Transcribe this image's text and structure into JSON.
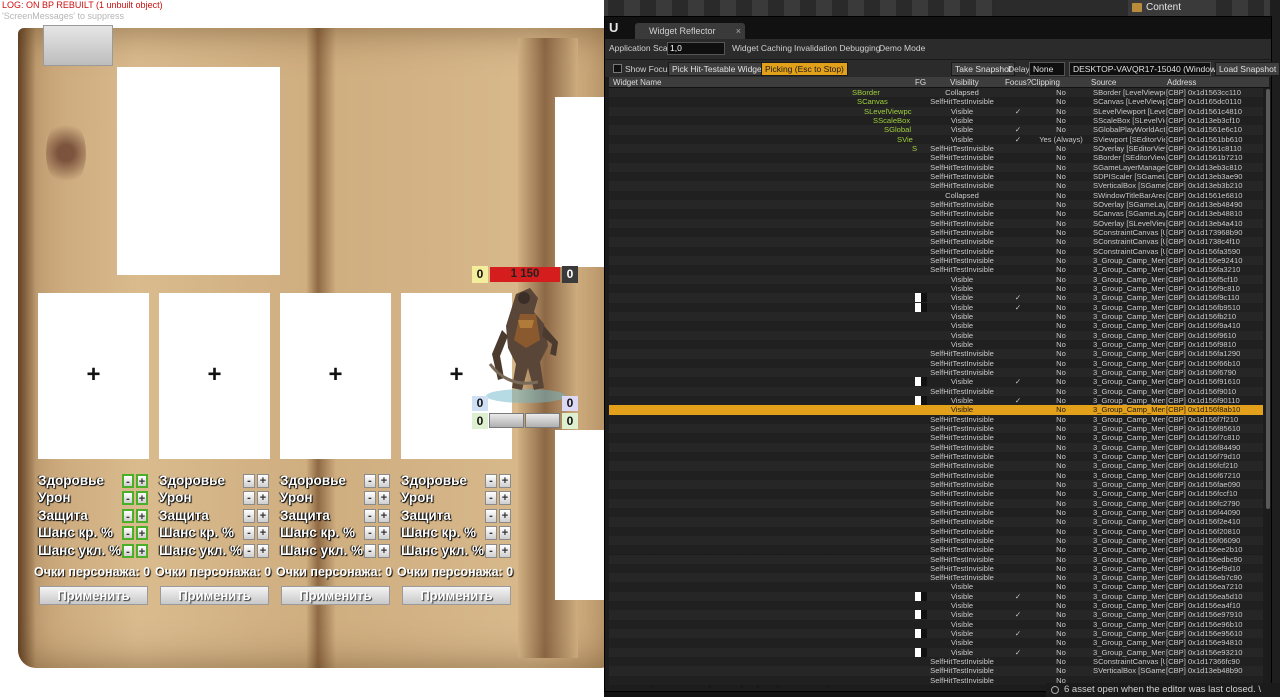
{
  "debug": {
    "message": "LOG: ON BP REBUILT (1 unbuilt object)",
    "hint": "'ScreenMessages' to suppress"
  },
  "game": {
    "slots": [
      "+",
      "+",
      "+",
      "+"
    ],
    "stat_labels": [
      "Здоровье",
      "Урон",
      "Защита",
      "Шанс кр. %",
      "Шанс укл. %"
    ],
    "minus": "-",
    "plus": "+",
    "points_label": "Очки персонажа:",
    "points_values": [
      "0",
      "0",
      "0",
      "0"
    ],
    "apply_label": "Применить",
    "enemy": {
      "stat_left": "0",
      "health": "1 150",
      "stat_right": "0",
      "bottom_tl": "0",
      "bottom_tr": "0",
      "bottom_bl": "0",
      "bottom_br": "0"
    }
  },
  "reflector": {
    "title": "Widget Reflector",
    "logo": "U",
    "tab_close": "×",
    "toolbar1": {
      "scale_label": "Application Scale:",
      "scale_value": "1,0",
      "widget_caching": "Widget Caching",
      "invalidation_debugging": "Invalidation Debugging",
      "demo_mode": "Demo Mode"
    },
    "toolbar2": {
      "show_focus": "Show Focus",
      "pick_hit_testable": "Pick Hit-Testable Widgets",
      "picking": "Picking (Esc to Stop)",
      "take_snapshot": "Take Snapshot",
      "delay_label": "Delay",
      "delay_value": "None",
      "target": "DESKTOP-VAVQR17-15040 (Windows)",
      "load_snapshot": "Load Snapshot"
    },
    "columns": [
      "Widget Name",
      "FG",
      "Visibility",
      "Focus?",
      "Clipping",
      "Source",
      "Address"
    ],
    "rows": [
      {
        "name": "SBorder",
        "vis": "Collapsed",
        "focus": "",
        "clip": "No",
        "src": "SBorder [LevelViewport",
        "addr": "[CBP] 0x1d1563cc110",
        "fg": false
      },
      {
        "name": "SCanvas",
        "vis": "SelfHitTestInvisible",
        "focus": "",
        "clip": "No",
        "src": "SCanvas [LevelViewport",
        "addr": "[CBP] 0x1d165dc0110",
        "fg": false
      },
      {
        "name": "SLevelViewpc",
        "vis": "Visible",
        "focus": "✓",
        "clip": "No",
        "src": "SLevelViewport [Level",
        "addr": "[CBP] 0x1d1561c4810",
        "fg": false
      },
      {
        "name": "SScaleBox",
        "vis": "Visible",
        "focus": "",
        "clip": "No",
        "src": "SScaleBox [SLevelViewp",
        "addr": "[CBP] 0x1d13eb3cf10",
        "fg": false
      },
      {
        "name": "SGlobal",
        "vis": "Visible",
        "focus": "✓",
        "clip": "No",
        "src": "SGlobalPlayWorldActio",
        "addr": "[CBP] 0x1d1561e6c10",
        "fg": false
      },
      {
        "name": "SVie",
        "vis": "Visible",
        "focus": "✓",
        "clip": "Yes (Always)",
        "src": "SViewport [SEditorView",
        "addr": "[CBP] 0x1d1561bb610",
        "fg": false
      },
      {
        "name": "S",
        "vis": "SelfHitTestInvisible",
        "focus": "",
        "clip": "No",
        "src": "SOverlay [SEditorView",
        "addr": "[CBP] 0x1d1561c8110",
        "fg": false
      },
      {
        "name": "",
        "vis": "SelfHitTestInvisible",
        "focus": "",
        "clip": "No",
        "src": "SBorder [SEditorViewp",
        "addr": "[CBP] 0x1d1561b7210",
        "fg": false
      },
      {
        "name": "",
        "vis": "SelfHitTestInvisible",
        "focus": "",
        "clip": "No",
        "src": "SGameLayerManager [",
        "addr": "[CBP] 0x1d13eb3c810",
        "fg": false
      },
      {
        "name": "",
        "vis": "SelfHitTestInvisible",
        "focus": "",
        "clip": "No",
        "src": "SDPIScaler [SGameLay",
        "addr": "[CBP] 0x1d13eb3ae90",
        "fg": false
      },
      {
        "name": "",
        "vis": "SelfHitTestInvisible",
        "focus": "",
        "clip": "No",
        "src": "SVerticalBox [SGameLa",
        "addr": "[CBP] 0x1d13eb3b210",
        "fg": false
      },
      {
        "name": "",
        "vis": "Collapsed",
        "focus": "",
        "clip": "No",
        "src": "SWindowTitleBarArea [",
        "addr": "[CBP] 0x1d1561e6810",
        "fg": false
      },
      {
        "name": "",
        "vis": "SelfHitTestInvisible",
        "focus": "",
        "clip": "No",
        "src": "SOverlay [SGameLayer",
        "addr": "[CBP] 0x1d13eb48490",
        "fg": false
      },
      {
        "name": "",
        "vis": "SelfHitTestInvisible",
        "focus": "",
        "clip": "No",
        "src": "SCanvas [SGameLayerl",
        "addr": "[CBP] 0x1d13eb48810",
        "fg": false
      },
      {
        "name": "",
        "vis": "SelfHitTestInvisible",
        "focus": "",
        "clip": "No",
        "src": "SOverlay [SLevelViewp",
        "addr": "[CBP] 0x1d13eb4a410",
        "fg": false
      },
      {
        "name": "",
        "vis": "SelfHitTestInvisible",
        "focus": "",
        "clip": "No",
        "src": "SConstraintCanvas [Us",
        "addr": "[CBP] 0x1d173968b90",
        "fg": false
      },
      {
        "name": "",
        "vis": "SelfHitTestInvisible",
        "focus": "",
        "clip": "No",
        "src": "SConstraintCanvas [Us",
        "addr": "[CBP] 0x1d1738c4f10",
        "fg": false
      },
      {
        "name": "",
        "vis": "SelfHitTestInvisible",
        "focus": "",
        "clip": "No",
        "src": "SConstraintCanvas [Us",
        "addr": "[CBP] 0x1d156fa3590",
        "fg": false
      },
      {
        "name": "",
        "vis": "SelfHitTestInvisible",
        "focus": "",
        "clip": "No",
        "src": "3_Group_Camp_Menu [",
        "addr": "[CBP] 0x1d156e92410",
        "fg": false
      },
      {
        "name": "",
        "vis": "SelfHitTestInvisible",
        "focus": "",
        "clip": "No",
        "src": "3_Group_Camp_Menu [",
        "addr": "[CBP] 0x1d156fa3210",
        "fg": false
      },
      {
        "name": "",
        "vis": "Visible",
        "focus": "",
        "clip": "No",
        "src": "3_Group_Camp_Menu [",
        "addr": "[CBP] 0x1d156f5cf10",
        "fg": false
      },
      {
        "name": "",
        "vis": "Visible",
        "focus": "",
        "clip": "No",
        "src": "3_Group_Camp_Menu [",
        "addr": "[CBP] 0x1d156f9c810",
        "fg": false
      },
      {
        "name": "",
        "vis": "Visible",
        "focus": "✓",
        "clip": "No",
        "src": "3_Group_Camp_Menu [",
        "addr": "[CBP] 0x1d156f9c110",
        "fg": true
      },
      {
        "name": "",
        "vis": "Visible",
        "focus": "✓",
        "clip": "No",
        "src": "3_Group_Camp_Menu [",
        "addr": "[CBP] 0x1d156fb9510",
        "fg": true
      },
      {
        "name": "",
        "vis": "Visible",
        "focus": "",
        "clip": "No",
        "src": "3_Group_Camp_Menu [",
        "addr": "[CBP] 0x1d156fb210",
        "fg": false
      },
      {
        "name": "",
        "vis": "Visible",
        "focus": "",
        "clip": "No",
        "src": "3_Group_Camp_Menu [",
        "addr": "[CBP] 0x1d156f9a410",
        "fg": false
      },
      {
        "name": "",
        "vis": "Visible",
        "focus": "",
        "clip": "No",
        "src": "3_Group_Camp_Menu [",
        "addr": "[CBP] 0x1d156f9610",
        "fg": false
      },
      {
        "name": "",
        "vis": "Visible",
        "focus": "",
        "clip": "No",
        "src": "3_Group_Camp_Menu [",
        "addr": "[CBP] 0x1d156f9810",
        "fg": false
      },
      {
        "name": "",
        "vis": "SelfHitTestInvisible",
        "focus": "",
        "clip": "No",
        "src": "3_Group_Camp_Menu [",
        "addr": "[CBP] 0x1d156fa1290",
        "fg": false
      },
      {
        "name": "",
        "vis": "SelfHitTestInvisible",
        "focus": "",
        "clip": "No",
        "src": "3_Group_Camp_Menu [",
        "addr": "[CBP] 0x1d156f66b10",
        "fg": false
      },
      {
        "name": "",
        "vis": "SelfHitTestInvisible",
        "focus": "",
        "clip": "No",
        "src": "3_Group_Camp_Menu [",
        "addr": "[CBP] 0x1d156f6790",
        "fg": false
      },
      {
        "name": "",
        "vis": "Visible",
        "focus": "✓",
        "clip": "No",
        "src": "3_Group_Camp_Menu [",
        "addr": "[CBP] 0x1d156f91610",
        "fg": true
      },
      {
        "name": "",
        "vis": "SelfHitTestInvisible",
        "focus": "",
        "clip": "No",
        "src": "3_Group_Camp_Menu [",
        "addr": "[CBP] 0x1d156f9010",
        "fg": false
      },
      {
        "name": "",
        "vis": "Visible",
        "focus": "✓",
        "clip": "No",
        "src": "3_Group_Camp_Menu [",
        "addr": "[CBP] 0x1d156f90110",
        "fg": true
      },
      {
        "name": "",
        "vis": "Visible",
        "focus": "",
        "clip": "No",
        "src": "3_Group_Camp_Menu [",
        "addr": "[CBP] 0x1d156f8ab10",
        "fg": false,
        "selected": true
      },
      {
        "name": "",
        "vis": "SelfHitTestInvisible",
        "focus": "",
        "clip": "No",
        "src": "3_Group_Camp_Menu [",
        "addr": "[CBP] 0x1d156f7f210",
        "fg": false
      },
      {
        "name": "",
        "vis": "SelfHitTestInvisible",
        "focus": "",
        "clip": "No",
        "src": "3_Group_Camp_Menu [",
        "addr": "[CBP] 0x1d156f85610",
        "fg": false
      },
      {
        "name": "",
        "vis": "SelfHitTestInvisible",
        "focus": "",
        "clip": "No",
        "src": "3_Group_Camp_Menu [",
        "addr": "[CBP] 0x1d156f7c810",
        "fg": false
      },
      {
        "name": "",
        "vis": "SelfHitTestInvisible",
        "focus": "",
        "clip": "No",
        "src": "3_Group_Camp_Menu [",
        "addr": "[CBP] 0x1d156f84490",
        "fg": false
      },
      {
        "name": "",
        "vis": "SelfHitTestInvisible",
        "focus": "",
        "clip": "No",
        "src": "3_Group_Camp_Menu [",
        "addr": "[CBP] 0x1d156f79d10",
        "fg": false
      },
      {
        "name": "",
        "vis": "SelfHitTestInvisible",
        "focus": "",
        "clip": "No",
        "src": "3_Group_Camp_Menu [",
        "addr": "[CBP] 0x1d156fcf210",
        "fg": false
      },
      {
        "name": "",
        "vis": "SelfHitTestInvisible",
        "focus": "",
        "clip": "No",
        "src": "3_Group_Camp_Menu [",
        "addr": "[CBP] 0x1d156f67210",
        "fg": false
      },
      {
        "name": "",
        "vis": "SelfHitTestInvisible",
        "focus": "",
        "clip": "No",
        "src": "3_Group_Camp_Menu [",
        "addr": "[CBP] 0x1d156fae090",
        "fg": false
      },
      {
        "name": "",
        "vis": "SelfHitTestInvisible",
        "focus": "",
        "clip": "No",
        "src": "3_Group_Camp_Menu [",
        "addr": "[CBP] 0x1d156fccf10",
        "fg": false
      },
      {
        "name": "",
        "vis": "SelfHitTestInvisible",
        "focus": "",
        "clip": "No",
        "src": "3_Group_Camp_Menu [",
        "addr": "[CBP] 0x1d156fc2790",
        "fg": false
      },
      {
        "name": "",
        "vis": "SelfHitTestInvisible",
        "focus": "",
        "clip": "No",
        "src": "3_Group_Camp_Menu [",
        "addr": "[CBP] 0x1d156f44090",
        "fg": false
      },
      {
        "name": "",
        "vis": "SelfHitTestInvisible",
        "focus": "",
        "clip": "No",
        "src": "3_Group_Camp_Menu [",
        "addr": "[CBP] 0x1d156f2e410",
        "fg": false
      },
      {
        "name": "",
        "vis": "SelfHitTestInvisible",
        "focus": "",
        "clip": "No",
        "src": "3_Group_Camp_Menu [",
        "addr": "[CBP] 0x1d156f20810",
        "fg": false
      },
      {
        "name": "",
        "vis": "SelfHitTestInvisible",
        "focus": "",
        "clip": "No",
        "src": "3_Group_Camp_Menu [",
        "addr": "[CBP] 0x1d156f06090",
        "fg": false
      },
      {
        "name": "",
        "vis": "SelfHitTestInvisible",
        "focus": "",
        "clip": "No",
        "src": "3_Group_Camp_Menu [",
        "addr": "[CBP] 0x1d156ee2b10",
        "fg": false
      },
      {
        "name": "",
        "vis": "SelfHitTestInvisible",
        "focus": "",
        "clip": "No",
        "src": "3_Group_Camp_Menu [",
        "addr": "[CBP] 0x1d156edbc90",
        "fg": false
      },
      {
        "name": "",
        "vis": "SelfHitTestInvisible",
        "focus": "",
        "clip": "No",
        "src": "3_Group_Camp_Menu [",
        "addr": "[CBP] 0x1d156ef9d10",
        "fg": false
      },
      {
        "name": "",
        "vis": "SelfHitTestInvisible",
        "focus": "",
        "clip": "No",
        "src": "3_Group_Camp_Menu [",
        "addr": "[CBP] 0x1d156eb7c90",
        "fg": false
      },
      {
        "name": "",
        "vis": "Visible",
        "focus": "",
        "clip": "No",
        "src": "3_Group_Camp_Menu [",
        "addr": "[CBP] 0x1d156ea7210",
        "fg": false
      },
      {
        "name": "",
        "vis": "Visible",
        "focus": "✓",
        "clip": "No",
        "src": "3_Group_Camp_Menu [",
        "addr": "[CBP] 0x1d156ea5d10",
        "fg": true
      },
      {
        "name": "",
        "vis": "Visible",
        "focus": "",
        "clip": "No",
        "src": "3_Group_Camp_Menu [",
        "addr": "[CBP] 0x1d156ea4f10",
        "fg": false
      },
      {
        "name": "",
        "vis": "Visible",
        "focus": "✓",
        "clip": "No",
        "src": "3_Group_Camp_Menu [",
        "addr": "[CBP] 0x1d156e97910",
        "fg": true
      },
      {
        "name": "",
        "vis": "Visible",
        "focus": "",
        "clip": "No",
        "src": "3_Group_Camp_Menu [",
        "addr": "[CBP] 0x1d156e96b10",
        "fg": false
      },
      {
        "name": "",
        "vis": "Visible",
        "focus": "✓",
        "clip": "No",
        "src": "3_Group_Camp_Menu [",
        "addr": "[CBP] 0x1d156e95610",
        "fg": true
      },
      {
        "name": "",
        "vis": "Visible",
        "focus": "",
        "clip": "No",
        "src": "3_Group_Camp_Menu [",
        "addr": "[CBP] 0x1d156e94810",
        "fg": false
      },
      {
        "name": "",
        "vis": "Visible",
        "focus": "✓",
        "clip": "No",
        "src": "3_Group_Camp_Menu [",
        "addr": "[CBP] 0x1d156e93210",
        "fg": true
      },
      {
        "name": "",
        "vis": "SelfHitTestInvisible",
        "focus": "",
        "clip": "No",
        "src": "SConstraintCanvas [Us",
        "addr": "[CBP] 0x1d17366fc90",
        "fg": false
      },
      {
        "name": "",
        "vis": "SelfHitTestInvisible",
        "focus": "",
        "clip": "No",
        "src": "SVerticalBox [SGameLa",
        "addr": "[CBP] 0x1d13eb48b90",
        "fg": false
      },
      {
        "name": "",
        "vis": "SelfHitTestInvisible",
        "focus": "",
        "clip": "No",
        "src": "",
        "addr": "",
        "fg": false
      }
    ]
  },
  "editor": {
    "content_tab": "Content",
    "toast": "6 asset  open when the editor was last closed. \\"
  }
}
